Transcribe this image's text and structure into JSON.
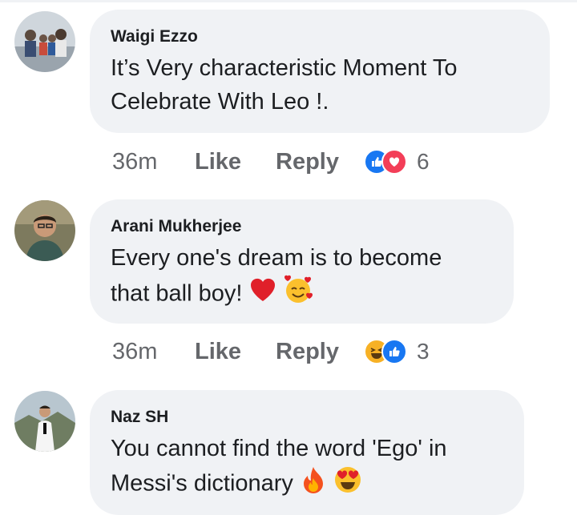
{
  "comments": [
    {
      "author": "Waigi Ezzo",
      "lines": [
        "It’s Very characteristic Moment To",
        "Celebrate With Leo !."
      ],
      "time": "36m",
      "like_label": "Like",
      "reply_label": "Reply",
      "reactions": [
        "like-icon",
        "love-icon"
      ],
      "reaction_count": "6"
    },
    {
      "author": "Arani Mukherjee",
      "lines": [
        "Every one's dream is to become",
        "that ball boy!"
      ],
      "emojis": [
        "red-heart-emoji",
        "smiling-face-with-hearts-emoji"
      ],
      "time": "36m",
      "like_label": "Like",
      "reply_label": "Reply",
      "reactions": [
        "haha-icon",
        "like-icon"
      ],
      "reaction_count": "3"
    },
    {
      "author": "Naz SH",
      "lines": [
        "You cannot find the word 'Ego' in",
        "Messi's dictionary"
      ],
      "emojis": [
        "fire-emoji",
        "heart-eyes-emoji"
      ]
    }
  ],
  "colors": {
    "bubble": "#f0f2f5",
    "meta_text": "#65676b",
    "like_blue": "#1877f2",
    "love_red": "#f33e58",
    "haha_yellow": "#f7b125"
  }
}
